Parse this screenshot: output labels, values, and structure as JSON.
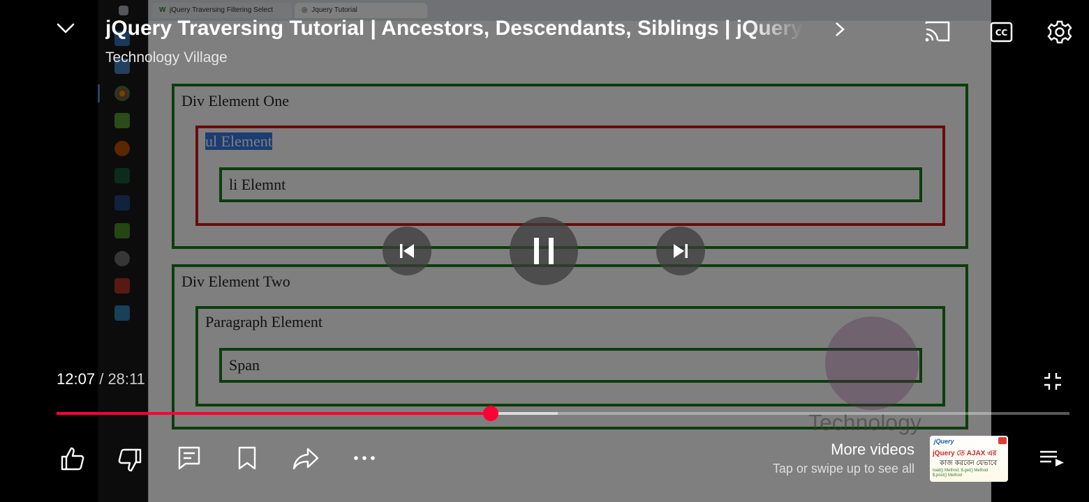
{
  "player": {
    "title": "jQuery Traversing Tutorial | Ancestors, Descendants, Siblings | jQuery",
    "channel": "Technology Village",
    "current_time": "12:07",
    "separator": "/",
    "duration": "28:11",
    "progress_fraction": 0.429,
    "buffered_fraction": 0.495,
    "more_videos_title": "More videos",
    "more_videos_subtitle": "Tap or swipe up to see all",
    "accent_color": "#ff0033"
  },
  "video_content": {
    "tabs": [
      {
        "label": "jQuery Traversing Filtering Select"
      },
      {
        "label": "Jquery Tutorial"
      }
    ],
    "div_one": "Div Element One",
    "ul_element": "ul Element",
    "li_element": "li Elemnt",
    "div_two": "Div Element Two",
    "paragraph_element": "Paragraph Element",
    "span_element": "Span",
    "watermark": "Technology"
  },
  "thumbnail": {
    "brand": "jQuery",
    "headline": "jQuery তে AJAX এর",
    "subline": "কাজ করবেন যেভাবে",
    "methods": "load() Method, $.get() Method\n$.post() Method"
  },
  "icons": [
    "chevron-down-icon",
    "cast-icon",
    "closed-captions-icon",
    "settings-icon",
    "previous-icon",
    "pause-icon",
    "next-icon",
    "exit-fullscreen-icon",
    "like-icon",
    "dislike-icon",
    "comments-icon",
    "save-icon",
    "share-icon",
    "more-icon",
    "playlist-icon"
  ]
}
